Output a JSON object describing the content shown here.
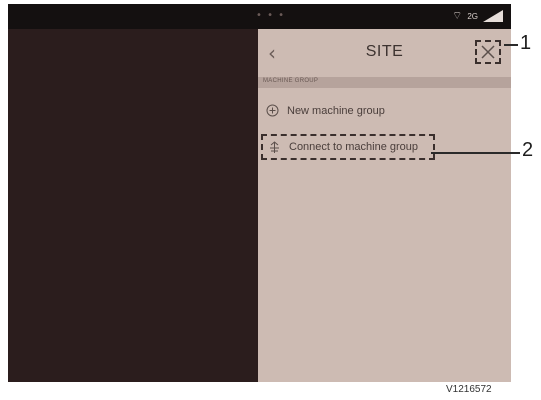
{
  "status_bar": {
    "dots": "• • •",
    "network": "2G"
  },
  "panel": {
    "title": "SITE",
    "back_icon": "chevron-left-icon",
    "close_icon": "close-icon",
    "section_label": "MACHINE GROUP",
    "items": [
      {
        "label": "New machine group",
        "icon": "add-circle-icon"
      },
      {
        "label": "Connect to machine group",
        "icon": "connect-icon"
      }
    ]
  },
  "callouts": [
    "1",
    "2"
  ],
  "figure_code": "V1216572"
}
